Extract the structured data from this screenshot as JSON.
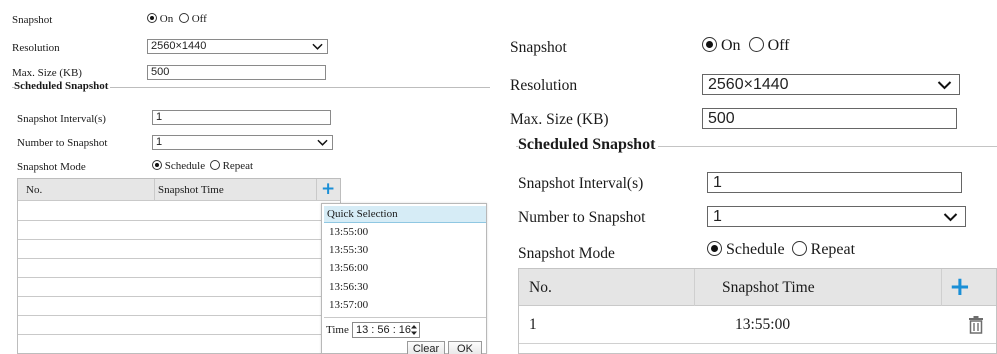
{
  "form": {
    "snapshot_label": "Snapshot",
    "on_label": "On",
    "off_label": "Off",
    "snapshot_selected": "On",
    "resolution_label": "Resolution",
    "resolution_value": "2560×1440",
    "max_size_label": "Max. Size (KB)",
    "max_size_value": "500",
    "scheduled_legend": "Scheduled Snapshot",
    "interval_label": "Snapshot Interval(s)",
    "interval_value": "1",
    "number_label": "Number to Snapshot",
    "number_value": "1",
    "mode_label": "Snapshot Mode",
    "schedule_label": "Schedule",
    "repeat_label": "Repeat",
    "mode_selected": "Schedule"
  },
  "table": {
    "col_no": "No.",
    "col_time": "Snapshot Time",
    "rows": [
      {
        "no": "1",
        "time": "13:55:00"
      }
    ]
  },
  "quick_selection": {
    "title": "Quick Selection",
    "items": [
      "13:55:00",
      "13:55:30",
      "13:56:00",
      "13:56:30",
      "13:57:00"
    ],
    "time_label": "Time",
    "time_value": "13 : 56 : 16",
    "clear_label": "Clear",
    "ok_label": "OK"
  },
  "icons": {
    "add": "plus-icon",
    "delete": "trash-icon",
    "dropdown": "chevron-down-icon",
    "spinner": "spinner-arrows-icon"
  },
  "colors": {
    "accent_blue": "#1a8fd6",
    "header_gray": "#e5e5e5",
    "quick_selection_bg": "#d6ecf6"
  }
}
